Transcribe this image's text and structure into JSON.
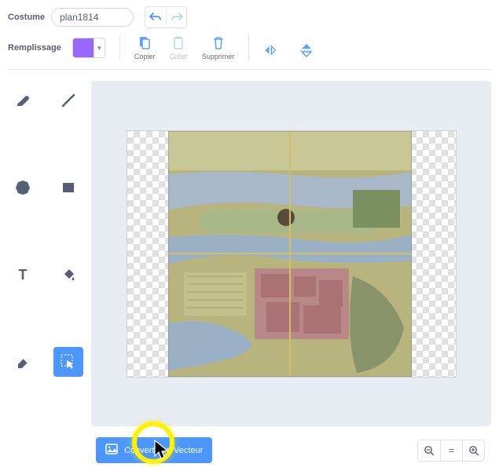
{
  "header": {
    "costume_label": "Costume",
    "costume_name": "plan1814"
  },
  "fill": {
    "label": "Remplissage",
    "color": "#9966ff"
  },
  "actions": {
    "copy": "Copier",
    "paste": "Coller",
    "delete": "Supprimer"
  },
  "tools": {
    "brush": "brush",
    "line": "line",
    "circle": "circle",
    "rect": "rect",
    "text": "text",
    "fillbucket": "fill",
    "eraser": "eraser",
    "select": "select"
  },
  "bottom": {
    "convert_label": "Convertir en Vecteur"
  },
  "zoom": {
    "out": "-",
    "reset": "=",
    "in": "+"
  }
}
